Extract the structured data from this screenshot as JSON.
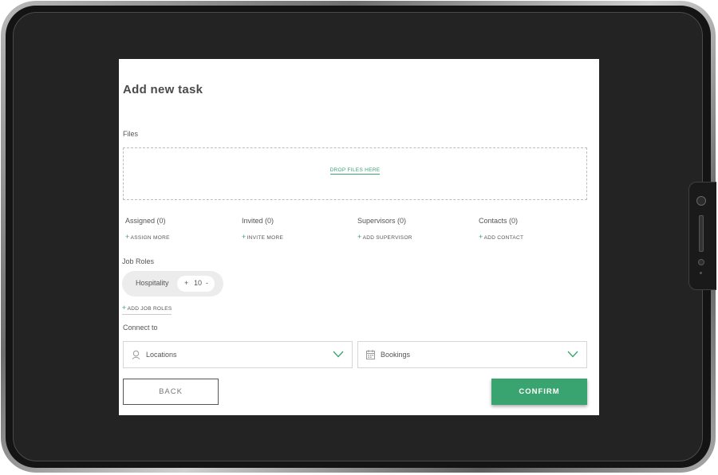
{
  "modal": {
    "title": "Add new task"
  },
  "files": {
    "label": "Files",
    "drop_text": "DROP FILES HERE"
  },
  "people": [
    {
      "title": "Assigned (0)",
      "action": "ASSIGN MORE"
    },
    {
      "title": "Invited (0)",
      "action": "INVITE MORE"
    },
    {
      "title": "Supervisors (0)",
      "action": "ADD SUPERVISOR"
    },
    {
      "title": "Contacts (0)",
      "action": "ADD CONTACT"
    }
  ],
  "job_roles": {
    "label": "Job Roles",
    "items": [
      {
        "name": "Hospitality",
        "plus": "+",
        "count": "10",
        "minus": "-"
      }
    ],
    "add_label": "ADD JOB ROLES"
  },
  "connect": {
    "label": "Connect to",
    "locations": {
      "text": "Locations",
      "icon": "location-pin-icon"
    },
    "bookings": {
      "text": "Bookings",
      "icon": "calendar-icon"
    }
  },
  "actions": {
    "back": "BACK",
    "confirm": "CONFIRM"
  },
  "colors": {
    "accent": "#3aa471",
    "device_bezel": "#232323"
  }
}
